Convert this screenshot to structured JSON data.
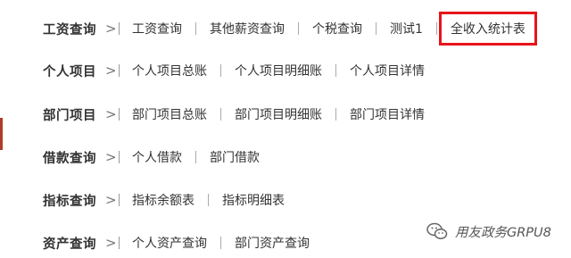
{
  "menu": {
    "rows": [
      {
        "title": "工资查询",
        "items": [
          "工资查询",
          "其他薪资查询",
          "个税查询",
          "测试1",
          "全收入统计表"
        ]
      },
      {
        "title": "个人项目",
        "items": [
          "个人项目总账",
          "个人项目明细账",
          "个人项目详情"
        ]
      },
      {
        "title": "部门项目",
        "items": [
          "部门项目总账",
          "部门项目明细账",
          "部门项目详情"
        ]
      },
      {
        "title": "借款查询",
        "items": [
          "个人借款",
          "部门借款"
        ]
      },
      {
        "title": "指标查询",
        "items": [
          "指标余额表",
          "指标明细表"
        ]
      },
      {
        "title": "资产查询",
        "items": [
          "个人资产查询",
          "部门资产查询"
        ]
      }
    ],
    "separator_glyph": ">",
    "highlighted_item": "全收入统计表"
  },
  "watermark": {
    "text": "用友政务GRPU8",
    "icon": "wechat-icon"
  },
  "colors": {
    "highlight_border": "#e8141a",
    "left_accent": "#b23a2a",
    "text": "#333333"
  }
}
